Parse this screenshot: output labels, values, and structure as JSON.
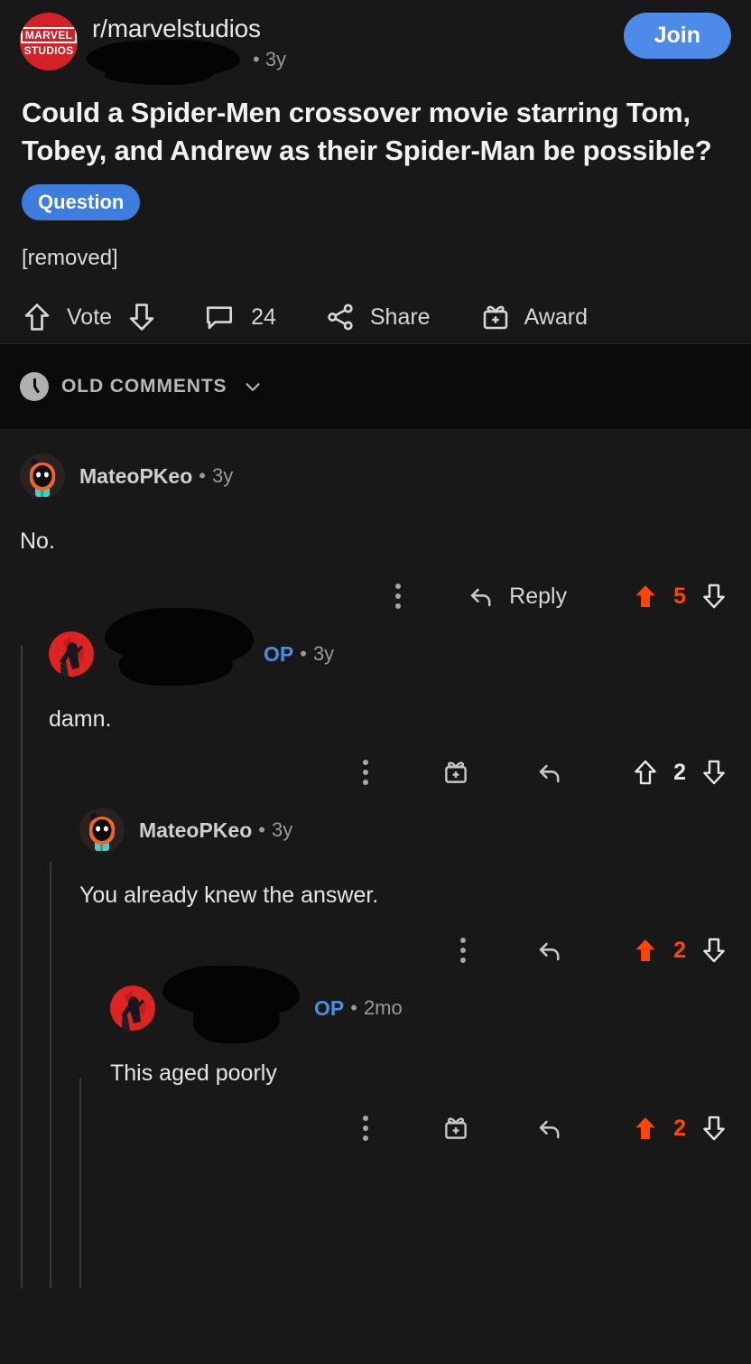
{
  "post": {
    "subreddit": "r/marvelstudios",
    "subreddit_avatar_line1": "MARVEL",
    "subreddit_avatar_line2": "STUDIOS",
    "author_redacted": true,
    "age": "• 3y",
    "join_label": "Join",
    "title": "Could a Spider-Men crossover movie starring Tom, Tobey, and Andrew as their Spider-Man be possible?",
    "flair": "Question",
    "body": "[removed]",
    "actions": {
      "vote_label": "Vote",
      "comment_count": "24",
      "share_label": "Share",
      "award_label": "Award"
    }
  },
  "sort_bar": {
    "label": "OLD COMMENTS",
    "icon": "clock-icon",
    "chevron": "chevron-down-icon"
  },
  "comments": [
    {
      "id": "c1",
      "depth": 0,
      "username": "MateoPKeo",
      "is_op": false,
      "dot": "•",
      "age": "3y",
      "avatar": "snoo-orange-teal",
      "body": "No.",
      "has_award": false,
      "reply_label": "Reply",
      "vote_count": "5",
      "upvoted": true
    },
    {
      "id": "c2",
      "depth": 1,
      "username": "",
      "is_op": true,
      "op_label": "OP",
      "dot": "•",
      "age": "3y",
      "avatar": "spiderman-red",
      "body": "damn.",
      "has_award": true,
      "reply_label": "",
      "vote_count": "2",
      "upvoted": false
    },
    {
      "id": "c3",
      "depth": 2,
      "username": "MateoPKeo",
      "is_op": false,
      "dot": "•",
      "age": "3y",
      "avatar": "snoo-orange-teal",
      "body": "You already knew the answer.",
      "has_award": false,
      "reply_label": "",
      "vote_count": "2",
      "upvoted": true
    },
    {
      "id": "c4",
      "depth": 3,
      "username": "",
      "is_op": true,
      "op_label": "OP",
      "dot": "•",
      "age": "2mo",
      "avatar": "spiderman-red",
      "body": "This aged poorly",
      "has_award": true,
      "reply_label": "",
      "vote_count": "2",
      "upvoted": true
    }
  ],
  "colors": {
    "background": "#181818",
    "sort_bar_bg": "#0b0b0b",
    "upvote_orange": "#ff4500",
    "link_blue": "#4a8ee0",
    "join_blue": "#4e8ae8",
    "flair_blue": "#3d7ddd",
    "marvel_red": "#d42027",
    "thread_line": "#3a3a3a"
  }
}
